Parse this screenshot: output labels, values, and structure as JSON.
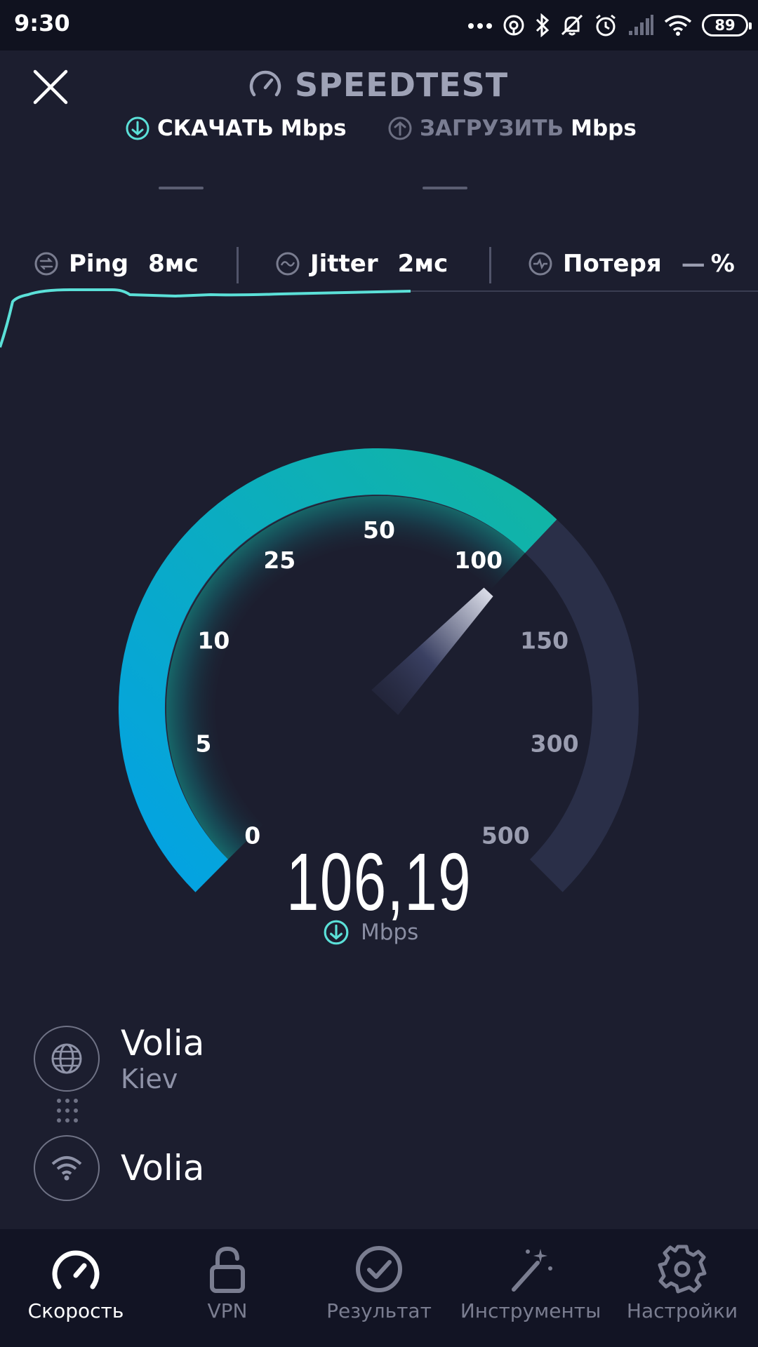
{
  "status_bar": {
    "time": "9:30",
    "battery": "89"
  },
  "header": {
    "title": "SPEEDTEST"
  },
  "metrics": {
    "download_label": "СКАЧАТЬ",
    "download_unit": "Mbps",
    "upload_label": "ЗАГРУЗИТЬ",
    "upload_unit": "Mbps"
  },
  "stats": {
    "ping_label": "Ping",
    "ping_value": "8мс",
    "jitter_label": "Jitter",
    "jitter_value": "2мс",
    "loss_label": "Потеря",
    "loss_value": "—",
    "loss_unit": "%"
  },
  "gauge": {
    "ticks": [
      "0",
      "5",
      "10",
      "25",
      "50",
      "100",
      "150",
      "300",
      "500"
    ],
    "fill_fraction": 0.66,
    "active_color": "#12b5a3",
    "start_color": "#03a2e4",
    "inactive_color": "#2a2f48"
  },
  "speed": {
    "value": "106,19",
    "unit": "Mbps"
  },
  "server": {
    "isp": "Volia",
    "city": "Kiev"
  },
  "connection": {
    "name": "Volia"
  },
  "nav": {
    "items": [
      {
        "label": "Скорость"
      },
      {
        "label": "VPN"
      },
      {
        "label": "Результат"
      },
      {
        "label": "Инструменты"
      },
      {
        "label": "Настройки"
      }
    ]
  }
}
